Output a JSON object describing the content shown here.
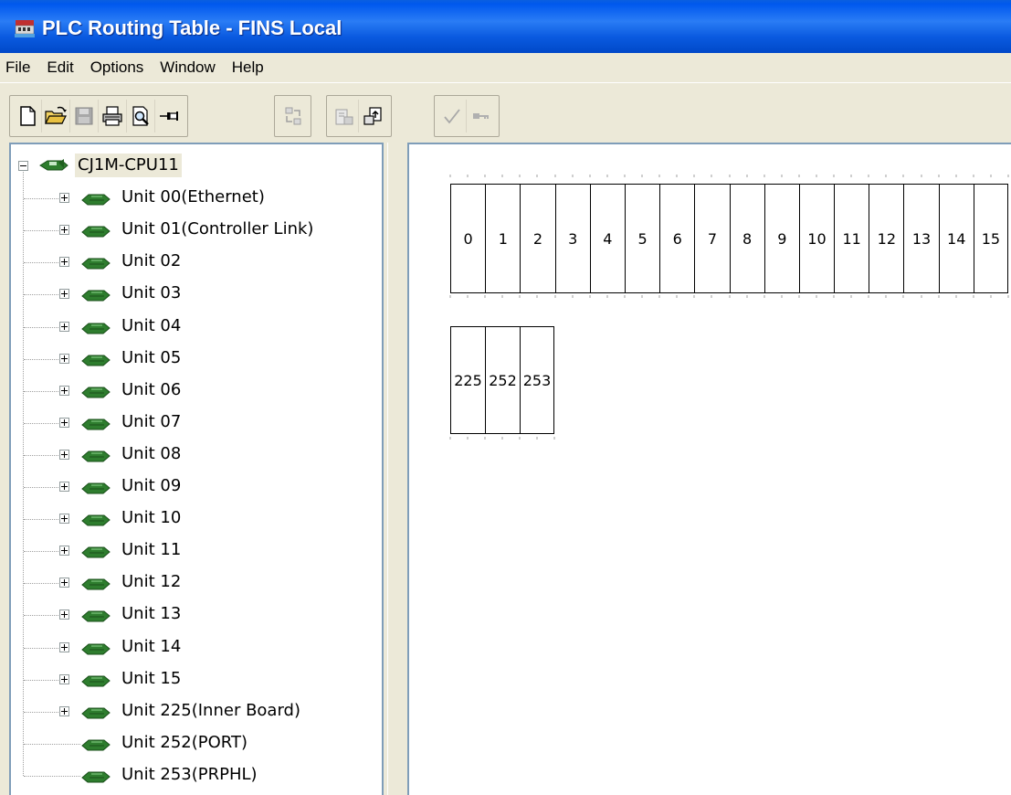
{
  "window": {
    "title": "PLC Routing Table - FINS Local"
  },
  "menu": [
    "File",
    "Edit",
    "Options",
    "Window",
    "Help"
  ],
  "toolbar": {
    "buttons": [
      {
        "icon": "new-file-icon",
        "enabled": true
      },
      {
        "icon": "open-folder-icon",
        "enabled": true
      },
      {
        "icon": "save-icon",
        "enabled": false
      },
      {
        "icon": "print-icon",
        "enabled": true
      },
      {
        "icon": "print-preview-icon",
        "enabled": true
      },
      {
        "icon": "pin-icon",
        "enabled": true
      },
      {
        "icon": "transfer-icon",
        "enabled": false
      },
      {
        "icon": "download-icon",
        "enabled": false
      },
      {
        "icon": "upload-icon",
        "enabled": true
      },
      {
        "icon": "check-icon",
        "enabled": false
      },
      {
        "icon": "key-icon",
        "enabled": false
      }
    ]
  },
  "tree": {
    "root": "CJ1M-CPU11",
    "units": [
      {
        "label": "Unit 00(Ethernet)",
        "expandable": true
      },
      {
        "label": "Unit 01(Controller Link)",
        "expandable": true
      },
      {
        "label": "Unit 02",
        "expandable": true
      },
      {
        "label": "Unit 03",
        "expandable": true
      },
      {
        "label": "Unit 04",
        "expandable": true
      },
      {
        "label": "Unit 05",
        "expandable": true
      },
      {
        "label": "Unit 06",
        "expandable": true
      },
      {
        "label": "Unit 07",
        "expandable": true
      },
      {
        "label": "Unit 08",
        "expandable": true
      },
      {
        "label": "Unit 09",
        "expandable": true
      },
      {
        "label": "Unit 10",
        "expandable": true
      },
      {
        "label": "Unit 11",
        "expandable": true
      },
      {
        "label": "Unit 12",
        "expandable": true
      },
      {
        "label": "Unit 13",
        "expandable": true
      },
      {
        "label": "Unit 14",
        "expandable": true
      },
      {
        "label": "Unit 15",
        "expandable": true
      },
      {
        "label": "Unit 225(Inner Board)",
        "expandable": true
      },
      {
        "label": "Unit 252(PORT)",
        "expandable": false
      },
      {
        "label": "Unit 253(PRPHL)",
        "expandable": false
      }
    ]
  },
  "rack": {
    "main_slots": [
      "0",
      "1",
      "2",
      "3",
      "4",
      "5",
      "6",
      "7",
      "8",
      "9",
      "10",
      "11",
      "12",
      "13",
      "14",
      "15"
    ],
    "extra_slots": [
      "225",
      "252",
      "253"
    ]
  },
  "colors": {
    "titlebar": "#0058ee",
    "window_bg": "#ece9d8",
    "unit_icon": "#2e7d2e"
  }
}
